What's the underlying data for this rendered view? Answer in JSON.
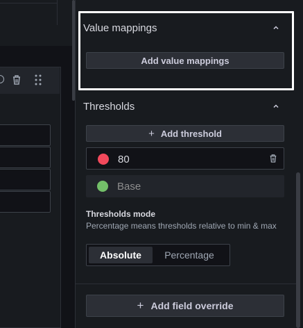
{
  "value_mappings": {
    "title": "Value mappings",
    "add_button": "Add value mappings"
  },
  "thresholds": {
    "title": "Thresholds",
    "add_button": "Add threshold",
    "items": [
      {
        "value": "80",
        "color": "#f2495c"
      },
      {
        "value": "Base",
        "color": "#73bf69"
      }
    ],
    "mode_label": "Thresholds mode",
    "mode_description": "Percentage means thresholds relative to min & max",
    "mode_options": [
      "Absolute",
      "Percentage"
    ],
    "mode_selected": "Absolute"
  },
  "override": {
    "add_button": "Add field override"
  },
  "colors": {
    "panel_bg": "#181b1f",
    "page_bg": "#111217",
    "button_bg": "#2c2f36",
    "red": "#f2495c",
    "green": "#73bf69",
    "highlight": "#ffffff"
  },
  "icons": [
    "eye-icon",
    "trash-icon",
    "drag-handle-icon",
    "chevron-up-icon",
    "plus-icon"
  ]
}
